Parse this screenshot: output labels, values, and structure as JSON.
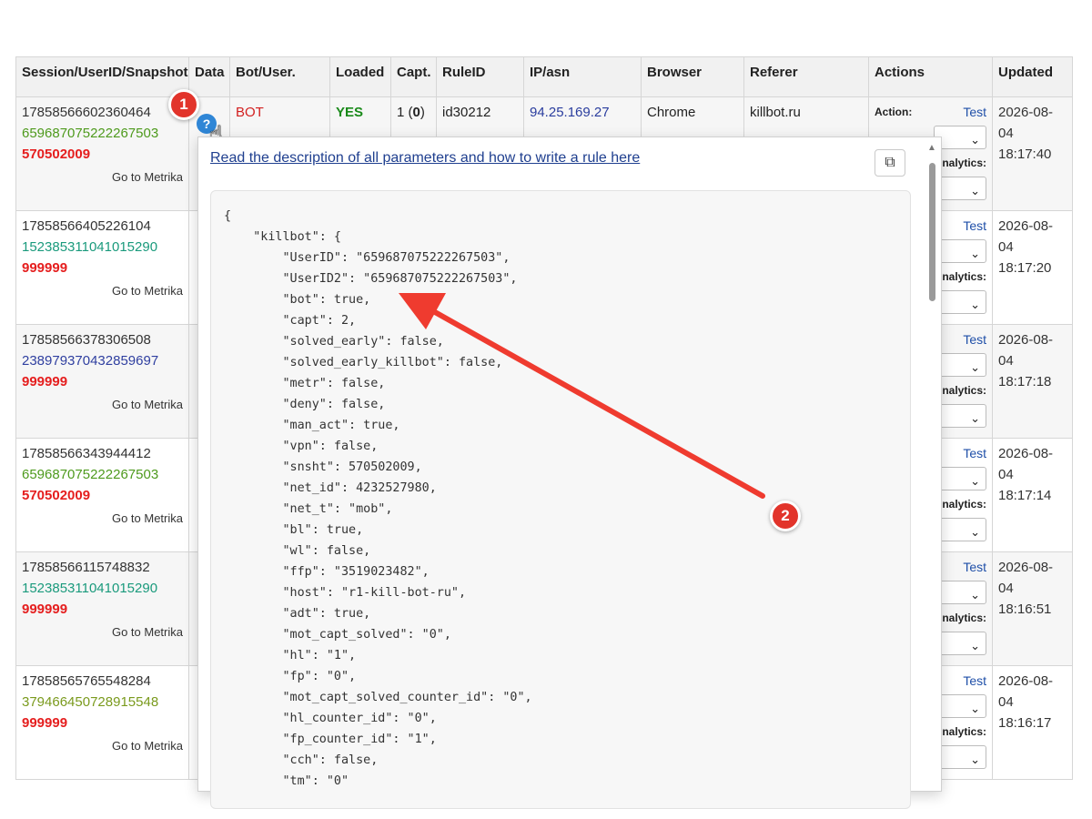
{
  "headers": [
    "Session/UserID/Snapshot",
    "Data",
    "Bot/User.",
    "Loaded",
    "Capt.",
    "RuleID",
    "IP/asn",
    "Browser",
    "Referer",
    "Actions",
    "Updated"
  ],
  "first_row": {
    "bot": "BOT",
    "loaded": "YES",
    "capt_main": "1",
    "capt_sub": "0",
    "rule": "id30212",
    "ip": "94.25.169.27",
    "browser": "Chrome",
    "referer": "killbot.ru",
    "action_label": "Action:"
  },
  "rows": [
    {
      "session": "17858566602360464",
      "uid": "659687075222267503",
      "snapshot": "570502009",
      "date": "2026-08-",
      "date2": "04",
      "time": "18:17:40"
    },
    {
      "session": "17858566405226104",
      "uid": "152385311041015290",
      "snapshot": "999999",
      "date": "2026-08-",
      "date2": "04",
      "time": "18:17:20"
    },
    {
      "session": "17858566378306508",
      "uid": "238979370432859697",
      "snapshot": "999999",
      "date": "2026-08-",
      "date2": "04",
      "time": "18:17:18"
    },
    {
      "session": "17858566343944412",
      "uid": "659687075222267503",
      "snapshot": "570502009",
      "date": "2026-08-",
      "date2": "04",
      "time": "18:17:14"
    },
    {
      "session": "17858566115748832",
      "uid": "152385311041015290",
      "snapshot": "999999",
      "date": "2026-08-",
      "date2": "04",
      "time": "18:16:51"
    },
    {
      "session": "17858565765548284",
      "uid": "379466450728915548",
      "snapshot": "999999",
      "date": "2026-08-",
      "date2": "04",
      "time": "18:16:17"
    }
  ],
  "metrika_link": "Go to Metrika",
  "test_link": "Test",
  "analytics_label": "nalytics:",
  "popup": {
    "link_text": "Read the description of all parameters and how to write a rule here",
    "json_text": "{\n    \"killbot\": {\n        \"UserID\": \"659687075222267503\",\n        \"UserID2\": \"659687075222267503\",\n        \"bot\": true,\n        \"capt\": 2,\n        \"solved_early\": false,\n        \"solved_early_killbot\": false,\n        \"metr\": false,\n        \"deny\": false,\n        \"man_act\": true,\n        \"vpn\": false,\n        \"snsht\": 570502009,\n        \"net_id\": 4232527980,\n        \"net_t\": \"mob\",\n        \"bl\": true,\n        \"wl\": false,\n        \"ffp\": \"3519023482\",\n        \"host\": \"r1-kill-bot-ru\",\n        \"adt\": true,\n        \"mot_capt_solved\": \"0\",\n        \"hl\": \"1\",\n        \"fp\": \"0\",\n        \"mot_capt_solved_counter_id\": \"0\",\n        \"hl_counter_id\": \"0\",\n        \"fp_counter_id\": \"1\",\n        \"cch\": false,\n        \"tm\": \"0\""
  },
  "annotations": {
    "badge1": "1",
    "badge2": "2"
  },
  "help_glyph": "?",
  "colors": {
    "badge": "#e2342b",
    "link": "#1f3f8f",
    "help": "#2f86d6",
    "bot": "#d21f1f",
    "yes": "#1a8a1a"
  }
}
